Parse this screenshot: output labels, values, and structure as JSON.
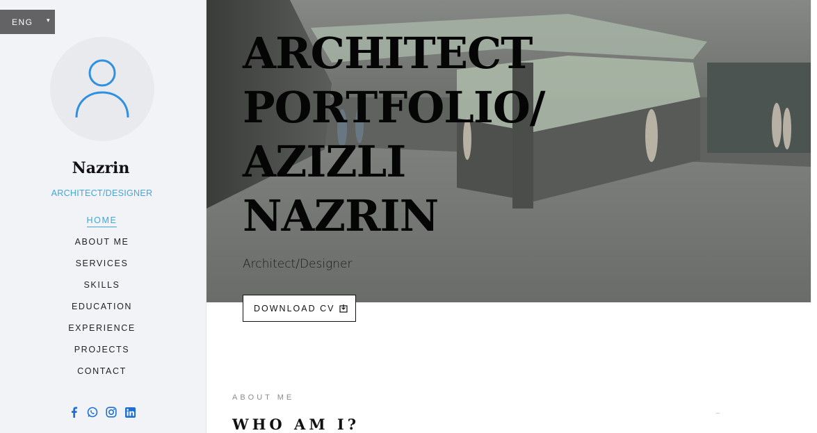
{
  "language": {
    "label": "ENG",
    "caret": "▾"
  },
  "profile": {
    "name": "Nazrin",
    "role": "ARCHITECT/DESIGNER"
  },
  "nav": {
    "items": [
      {
        "label": "HOME",
        "active": true
      },
      {
        "label": "ABOUT ME"
      },
      {
        "label": "SERVICES"
      },
      {
        "label": "SKILLS"
      },
      {
        "label": "EDUCATION"
      },
      {
        "label": "EXPERIENCE"
      },
      {
        "label": "PROJECTS"
      },
      {
        "label": "CONTACT"
      }
    ]
  },
  "social": [
    "facebook-icon",
    "whatsapp-icon",
    "instagram-icon",
    "linkedin-icon"
  ],
  "hero": {
    "title_lines": [
      "ARCHITECT",
      "PORTFOLIO/",
      "AZIZLI",
      "NAZRIN"
    ],
    "subtitle": "Architect/Designer",
    "cv_button": "DOWNLOAD CV"
  },
  "about": {
    "eyebrow": "ABOUT ME",
    "title": "WHO AM I?"
  },
  "colors": {
    "accent": "#3fa7de",
    "sidebar_bg": "#f2f3f7",
    "lang_bg": "#636366"
  }
}
